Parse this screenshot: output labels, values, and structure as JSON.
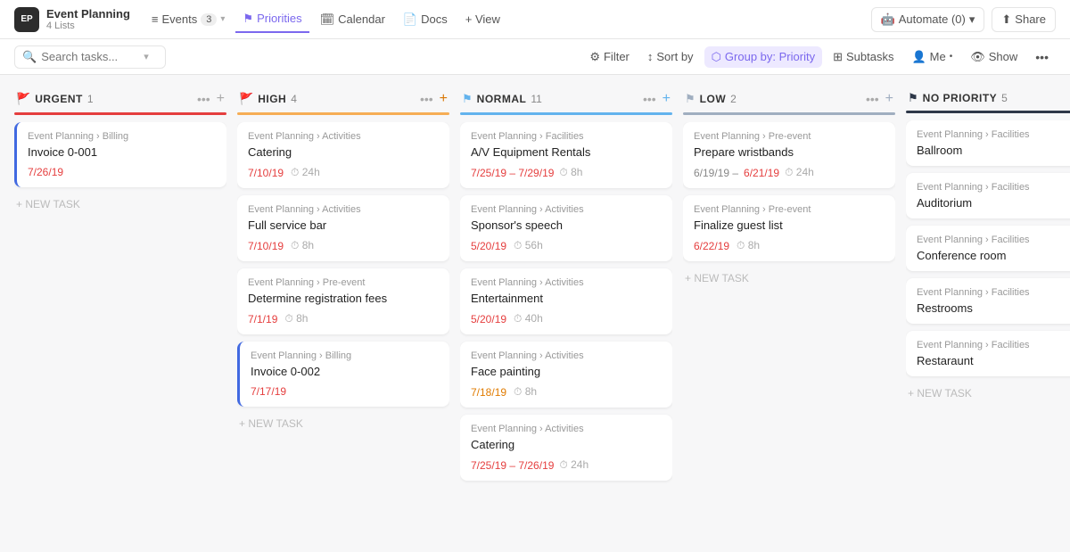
{
  "app": {
    "icon": "EP",
    "title": "Event Planning",
    "subtitle": "4 Lists"
  },
  "nav": {
    "items": [
      {
        "label": "Events",
        "badge": "3",
        "icon": "≡",
        "active": false
      },
      {
        "label": "Priorities",
        "icon": "⚑",
        "active": true
      },
      {
        "label": "Calendar",
        "icon": "□",
        "active": false
      },
      {
        "label": "Docs",
        "icon": "□",
        "active": false
      },
      {
        "label": "+ View",
        "icon": "",
        "active": false
      }
    ],
    "right": [
      {
        "label": "Automate (0)",
        "icon": "⚙"
      },
      {
        "label": "Share",
        "icon": "⬆"
      }
    ]
  },
  "toolbar": {
    "search_placeholder": "Search tasks...",
    "filter_label": "Filter",
    "sort_label": "Sort by",
    "group_label": "Group by: Priority",
    "subtasks_label": "Subtasks",
    "me_label": "Me",
    "show_label": "Show",
    "more_label": "..."
  },
  "columns": [
    {
      "id": "urgent",
      "title": "URGENT",
      "count": 1,
      "flag": "🚩",
      "border_class": "border-urgent",
      "cards": [
        {
          "breadcrumb": "Event Planning › Billing",
          "title": "Invoice 0-001",
          "date": "7/26/19",
          "date_color": "red",
          "duration": null,
          "accent": "card-invoice"
        }
      ]
    },
    {
      "id": "high",
      "title": "HIGH",
      "count": 4,
      "flag": "🚩",
      "flag_color": "orange",
      "border_class": "border-high",
      "cards": [
        {
          "breadcrumb": "Event Planning › Activities",
          "title": "Catering",
          "date": "7/10/19",
          "date_color": "red",
          "duration": "24h",
          "accent": ""
        },
        {
          "breadcrumb": "Event Planning › Activities",
          "title": "Full service bar",
          "date": "7/10/19",
          "date_color": "red",
          "duration": "8h",
          "accent": ""
        },
        {
          "breadcrumb": "Event Planning › Pre-event",
          "title": "Determine registration fees",
          "date": "7/1/19",
          "date_color": "red",
          "duration": "8h",
          "accent": ""
        },
        {
          "breadcrumb": "Event Planning › Billing",
          "title": "Invoice 0-002",
          "date": "7/17/19",
          "date_color": "red",
          "duration": null,
          "accent": "card-invoice"
        }
      ]
    },
    {
      "id": "normal",
      "title": "NORMAL",
      "count": 11,
      "flag": "⚑",
      "flag_color": "blue",
      "border_class": "border-normal",
      "cards": [
        {
          "breadcrumb": "Event Planning › Facilities",
          "title": "A/V Equipment Rentals",
          "date_range": "7/25/19 – 7/29/19",
          "date_color": "red",
          "duration": "8h",
          "accent": ""
        },
        {
          "breadcrumb": "Event Planning › Activities",
          "title": "Sponsor's speech",
          "date": "5/20/19",
          "date_color": "red",
          "duration": "56h",
          "accent": ""
        },
        {
          "breadcrumb": "Event Planning › Activities",
          "title": "Entertainment",
          "date": "5/20/19",
          "date_color": "red",
          "duration": "40h",
          "accent": ""
        },
        {
          "breadcrumb": "Event Planning › Activities",
          "title": "Face painting",
          "date": "7/18/19",
          "date_color": "orange",
          "duration": "8h",
          "accent": ""
        },
        {
          "breadcrumb": "Event Planning › Activities",
          "title": "Catering",
          "date_range": "7/25/19 – 7/26/19",
          "date_color": "red",
          "duration": "24h",
          "accent": ""
        }
      ]
    },
    {
      "id": "low",
      "title": "LOW",
      "count": 2,
      "flag": "⚑",
      "flag_color": "gray",
      "border_class": "border-low",
      "cards": [
        {
          "breadcrumb": "Event Planning › Pre-event",
          "title": "Prepare wristbands",
          "date_range": "6/19/19 – 6/21/19",
          "date_color": "red",
          "duration": "24h",
          "accent": ""
        },
        {
          "breadcrumb": "Event Planning › Pre-event",
          "title": "Finalize guest list",
          "date": "6/22/19",
          "date_color": "red",
          "duration": "8h",
          "accent": ""
        }
      ]
    },
    {
      "id": "no-priority",
      "title": "NO PRIORITY",
      "count": 5,
      "flag": "⚑",
      "flag_color": "black",
      "border_class": "border-none",
      "cards": [
        {
          "breadcrumb": "Event Planning › Facilities",
          "title": "Ballroom",
          "date": null,
          "duration": null,
          "accent": ""
        },
        {
          "breadcrumb": "Event Planning › Facilities",
          "title": "Auditorium",
          "date": null,
          "duration": null,
          "accent": ""
        },
        {
          "breadcrumb": "Event Planning › Facilities",
          "title": "Conference room",
          "date": null,
          "duration": null,
          "accent": ""
        },
        {
          "breadcrumb": "Event Planning › Facilities",
          "title": "Restrooms",
          "date": null,
          "duration": null,
          "accent": ""
        },
        {
          "breadcrumb": "Event Planning › Facilities",
          "title": "Restaraunt",
          "date": null,
          "duration": null,
          "accent": ""
        }
      ]
    }
  ],
  "new_task_label": "+ NEW TASK"
}
